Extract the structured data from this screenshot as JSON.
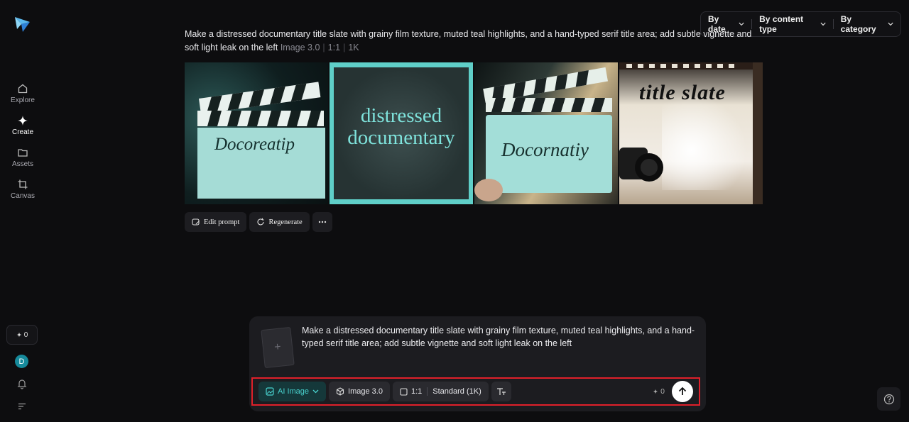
{
  "nav": {
    "items": [
      {
        "label": "Explore",
        "icon": "home-icon"
      },
      {
        "label": "Create",
        "icon": "sparkle-icon"
      },
      {
        "label": "Assets",
        "icon": "folder-icon"
      },
      {
        "label": "Canvas",
        "icon": "crop-icon"
      }
    ],
    "credits": "0",
    "avatar_initial": "D"
  },
  "filters": {
    "date": "By date",
    "content_type": "By content type",
    "category": "By category"
  },
  "result": {
    "prompt": "Make a distressed documentary title slate with grainy film texture, muted teal highlights, and a hand-typed serif title area; add subtle vignette and soft light leak on the left",
    "model": "Image 3.0",
    "ratio": "1:1",
    "resolution": "1K",
    "images": [
      {
        "text": "Docoreatip"
      },
      {
        "text_line1": "distressed",
        "text_line2": "documentary"
      },
      {
        "text": "Docornatiy"
      },
      {
        "text": "title slate"
      }
    ],
    "actions": {
      "edit": "Edit prompt",
      "regenerate": "Regenerate"
    }
  },
  "composer": {
    "text": "Make a distressed documentary title slate with grainy film texture, muted teal highlights, and a hand-typed serif title area; add subtle vignette and soft light leak on the left",
    "mode": "AI Image",
    "model": "Image 3.0",
    "ratio": "1:1",
    "quality": "Standard (1K)",
    "cost": "0",
    "accent_color": "#49d3cf",
    "highlight_color": "#e0202a"
  }
}
